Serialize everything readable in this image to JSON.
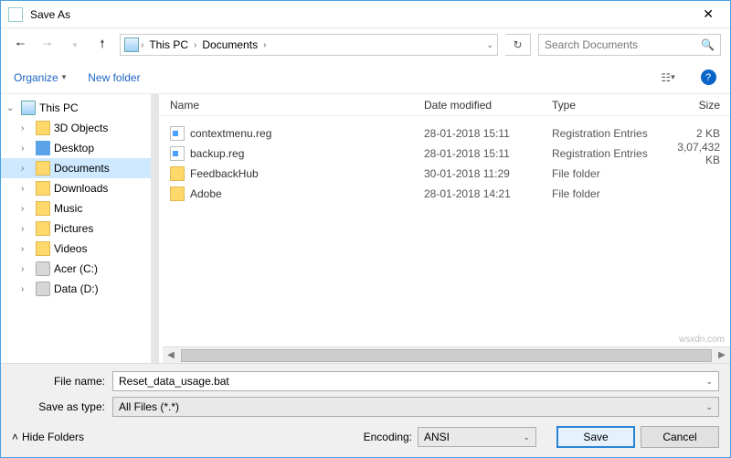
{
  "title": "Save As",
  "breadcrumb": {
    "root": "This PC",
    "folder": "Documents"
  },
  "search": {
    "placeholder": "Search Documents"
  },
  "toolbar": {
    "organize": "Organize",
    "newfolder": "New folder"
  },
  "tree": {
    "root": "This PC",
    "items": [
      {
        "label": "3D Objects"
      },
      {
        "label": "Desktop"
      },
      {
        "label": "Documents"
      },
      {
        "label": "Downloads"
      },
      {
        "label": "Music"
      },
      {
        "label": "Pictures"
      },
      {
        "label": "Videos"
      },
      {
        "label": "Acer (C:)"
      },
      {
        "label": "Data (D:)"
      }
    ]
  },
  "columns": {
    "name": "Name",
    "date": "Date modified",
    "type": "Type",
    "size": "Size"
  },
  "files": [
    {
      "name": "contextmenu.reg",
      "date": "28-01-2018 15:11",
      "type": "Registration Entries",
      "size": "2 KB",
      "kind": "reg"
    },
    {
      "name": "backup.reg",
      "date": "28-01-2018 15:11",
      "type": "Registration Entries",
      "size": "3,07,432 KB",
      "kind": "reg"
    },
    {
      "name": "FeedbackHub",
      "date": "30-01-2018 11:29",
      "type": "File folder",
      "size": "",
      "kind": "folder"
    },
    {
      "name": "Adobe",
      "date": "28-01-2018 14:21",
      "type": "File folder",
      "size": "",
      "kind": "folder"
    }
  ],
  "filename": {
    "label": "File name:",
    "value": "Reset_data_usage.bat"
  },
  "saveastype": {
    "label": "Save as type:",
    "value": "All Files (*.*)"
  },
  "encoding": {
    "label": "Encoding:",
    "value": "ANSI"
  },
  "buttons": {
    "save": "Save",
    "cancel": "Cancel",
    "hide": "Hide Folders"
  },
  "watermark": "wsxdn.com"
}
